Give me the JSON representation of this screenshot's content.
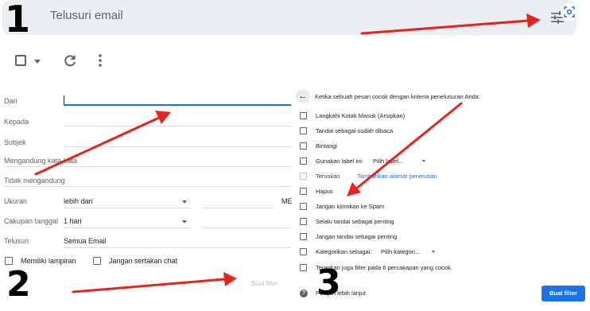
{
  "search": {
    "placeholder": "Telusuri email"
  },
  "annotations": {
    "one": "1",
    "two": "2",
    "three": "3"
  },
  "form": {
    "from_label": "Dari",
    "to_label": "Kepada",
    "subject_label": "Subjek",
    "has_words_label": "Mengandung kata-kata",
    "no_words_label": "Tidak mengandung",
    "size_label": "Ukuran",
    "size_operator": "lebih dari",
    "size_unit": "ME",
    "date_label": "Cakupan tanggal",
    "date_value": "1 hari",
    "search_label": "Telusuri",
    "search_value": "Semua Email",
    "has_attachment_label": "Memiliki lampiran",
    "exclude_chats_label": "Jangan sertakan chat",
    "create_filter_label": "Buat filter"
  },
  "actions": {
    "intro": "Ketika sebuah pesan cocok dengan kriteria penelusuran Anda:",
    "items": [
      "Langkahi Kotak Masuk (Arsipkan)",
      "Tandai sebagai sudah dibaca",
      "Bintangi",
      "Gunakan label ini:",
      "Teruskan",
      "Hapus",
      "Jangan kirimkan ke Spam",
      "Selalu tandai sebagai penting",
      "Jangan tandai sebagai penting",
      "Kategorikan sebagai:",
      "Terapkan juga filter pada 6 percakapan yang cocok."
    ],
    "label_select": "Pilih label...",
    "forward_link": "Tambahkan alamat penerusan",
    "category_select": "Pilih kategori...",
    "learn_more": "Pelajari lebih lanjut",
    "create_filter_button": "Buat filter"
  },
  "colors": {
    "accent": "#1a73e8",
    "arrow": "#e8231d"
  }
}
